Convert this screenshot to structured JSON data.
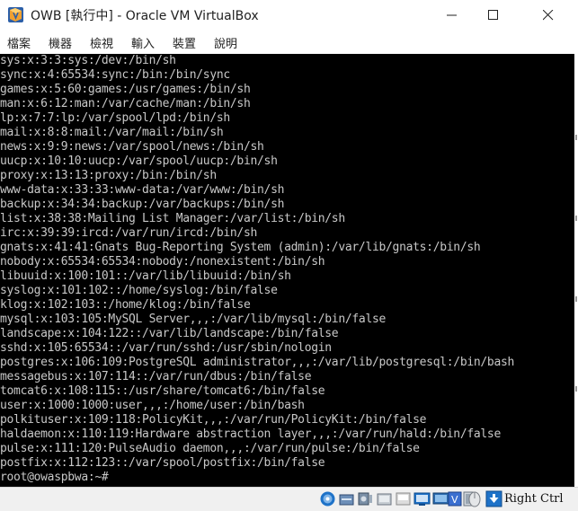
{
  "window": {
    "title": "OWB [執行中] - Oracle VM VirtualBox",
    "icon": "virtualbox-app-icon"
  },
  "menu": [
    "檔案",
    "機器",
    "檢視",
    "輸入",
    "裝置",
    "說明"
  ],
  "console": {
    "lines": [
      "sys:x:3:3:sys:/dev:/bin/sh",
      "sync:x:4:65534:sync:/bin:/bin/sync",
      "games:x:5:60:games:/usr/games:/bin/sh",
      "man:x:6:12:man:/var/cache/man:/bin/sh",
      "lp:x:7:7:lp:/var/spool/lpd:/bin/sh",
      "mail:x:8:8:mail:/var/mail:/bin/sh",
      "news:x:9:9:news:/var/spool/news:/bin/sh",
      "uucp:x:10:10:uucp:/var/spool/uucp:/bin/sh",
      "proxy:x:13:13:proxy:/bin:/bin/sh",
      "www-data:x:33:33:www-data:/var/www:/bin/sh",
      "backup:x:34:34:backup:/var/backups:/bin/sh",
      "list:x:38:38:Mailing List Manager:/var/list:/bin/sh",
      "irc:x:39:39:ircd:/var/run/ircd:/bin/sh",
      "gnats:x:41:41:Gnats Bug-Reporting System (admin):/var/lib/gnats:/bin/sh",
      "nobody:x:65534:65534:nobody:/nonexistent:/bin/sh",
      "libuuid:x:100:101::/var/lib/libuuid:/bin/sh",
      "syslog:x:101:102::/home/syslog:/bin/false",
      "klog:x:102:103::/home/klog:/bin/false",
      "mysql:x:103:105:MySQL Server,,,:/var/lib/mysql:/bin/false",
      "landscape:x:104:122::/var/lib/landscape:/bin/false",
      "sshd:x:105:65534::/var/run/sshd:/usr/sbin/nologin",
      "postgres:x:106:109:PostgreSQL administrator,,,:/var/lib/postgresql:/bin/bash",
      "messagebus:x:107:114::/var/run/dbus:/bin/false",
      "tomcat6:x:108:115::/usr/share/tomcat6:/bin/false",
      "user:x:1000:1000:user,,,:/home/user:/bin/bash",
      "polkituser:x:109:118:PolicyKit,,,:/var/run/PolicyKit:/bin/false",
      "haldaemon:x:110:119:Hardware abstraction layer,,,:/var/run/hald:/bin/false",
      "pulse:x:111:120:PulseAudio daemon,,,:/var/run/pulse:/bin/false",
      "postfix:x:112:123::/var/spool/postfix:/bin/false",
      "root@owaspbwa:~#"
    ]
  },
  "statusbar": {
    "icons": [
      "hard-disk-icon",
      "optical-drive-icon",
      "audio-icon",
      "network-icon",
      "usb-icon",
      "shared-folders-icon",
      "display-icon",
      "video-capture-icon",
      "cpu-icon",
      "mouse-integration-icon",
      "keyboard-capture-icon"
    ],
    "host_key": "Right Ctrl"
  },
  "colors": {
    "console_bg": "#000000",
    "console_text": "#c8c8c8",
    "statusbar_bg": "#f0f0f0",
    "accent_blue": "#1e72c8"
  }
}
